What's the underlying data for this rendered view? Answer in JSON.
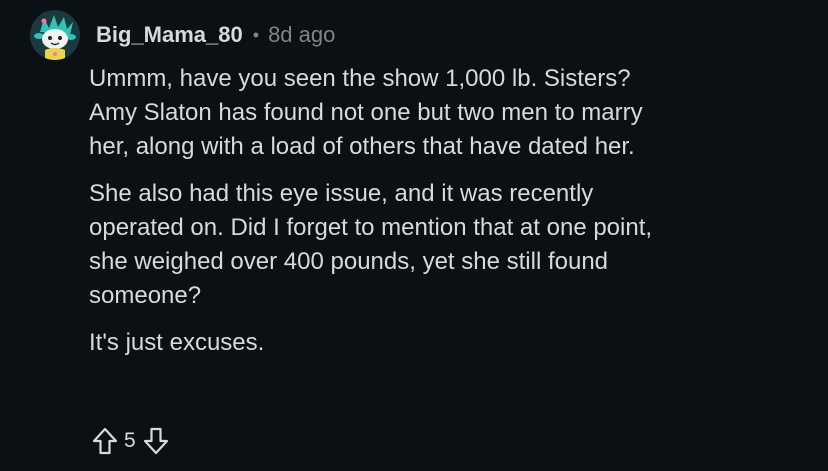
{
  "comment": {
    "username": "Big_Mama_80",
    "separator": "•",
    "age": "8d ago",
    "paragraphs": [
      "Ummm, have you seen the show 1,000 lb. Sisters?\nAmy Slaton has found not one but two men to marry\nher, along with a load of others that have dated her.",
      "She also had this eye issue, and it was recently\noperated on. Did I forget to mention that at one point,\nshe weighed over 400 pounds, yet she still found\nsomeone?",
      "It's just excuses."
    ],
    "score": "5",
    "icons": {
      "avatar": "snoo-avatar-icon",
      "upvote": "upvote-arrow-icon",
      "downvote": "downvote-arrow-icon"
    }
  },
  "colors": {
    "background": "#0b1015",
    "text": "#d7dadc",
    "muted": "#818384",
    "avatar_accent": "#2ec4b6"
  }
}
